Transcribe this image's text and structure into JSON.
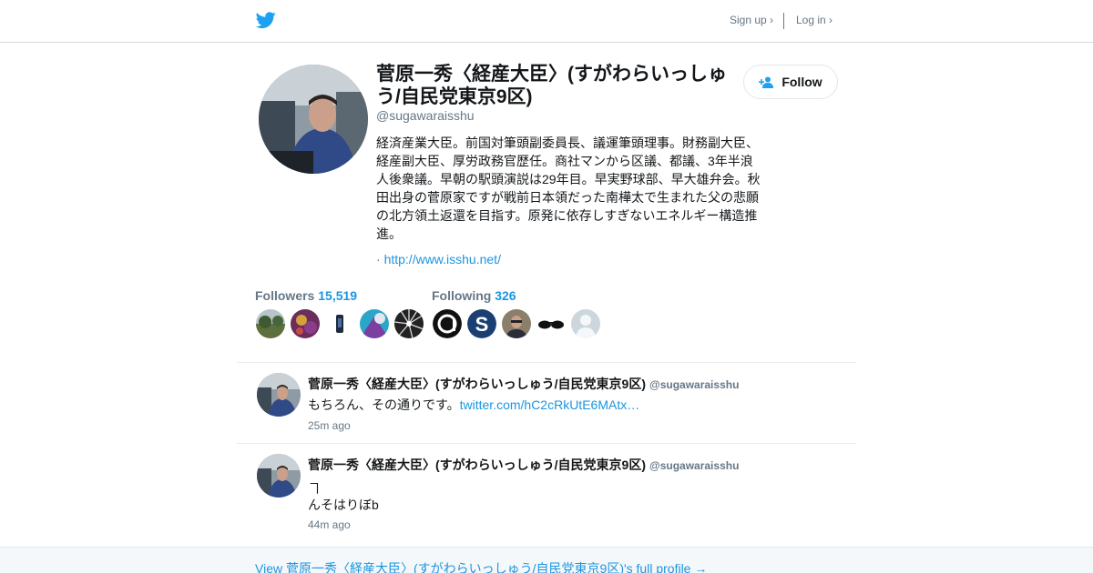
{
  "nav": {
    "signup": "Sign up ›",
    "login": "Log in ›"
  },
  "profile": {
    "name": "菅原一秀〈経産大臣〉(すがわらいっしゅう/自民党東京9区)",
    "handle": "@sugawaraisshu",
    "follow_label": "Follow",
    "bio": "経済産業大臣。前国対筆頭副委員長、議運筆頭理事。財務副大臣、経産副大臣、厚労政務官歴任。商社マンから区議、都議、3年半浪人後衆議。早朝の駅頭演説は29年目。早実野球部、早大雄弁会。秋田出身の菅原家ですが戦前日本領だった南樺太で生まれた父の悲願の北方領土返還を目指す。原発に依存しすぎないエネルギー構造推進。",
    "link_prefix": "·",
    "url": "http://www.isshu.net/"
  },
  "stats": {
    "followers_label": "Followers",
    "followers_count": "15,519",
    "following_label": "Following",
    "following_count": "326"
  },
  "tweets": [
    {
      "name": "菅原一秀〈経産大臣〉(すがわらいっしゅう/自民党東京9区)",
      "handle": "@sugawaraisshu",
      "text": "もちろん、その通りです。",
      "link": "twitter.com/hC2cRkUtE6MAtx…",
      "time": "25m ago"
    },
    {
      "name": "菅原一秀〈経産大臣〉(すがわらいっしゅう/自民党東京9区)",
      "handle": "@sugawaraisshu",
      "line1": "ヿ",
      "line2": "んそはりぼb",
      "time": "44m ago"
    }
  ],
  "footer": {
    "link": "View 菅原一秀〈経産大臣〉(すがわらいっしゅう/自民党東京9区)'s full profile →"
  },
  "icons": {
    "brand": "twitter-bird-icon",
    "follow": "add-user-icon"
  },
  "colors": {
    "accent": "#1b95e0",
    "bird": "#1da1f2",
    "muted": "#657786"
  }
}
